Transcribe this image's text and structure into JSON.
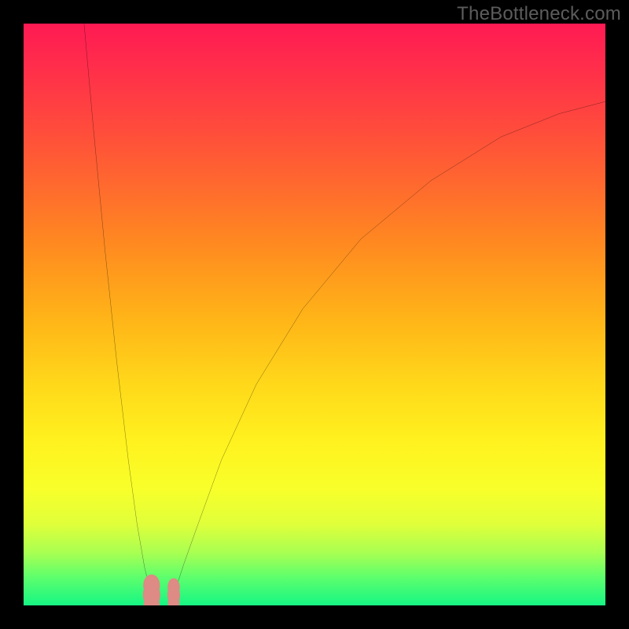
{
  "attribution": "TheBottleneck.com",
  "chart_data": {
    "type": "line",
    "title": "",
    "xlabel": "",
    "ylabel": "",
    "xlim": [
      0,
      100
    ],
    "ylim": [
      0,
      100
    ],
    "grid": false,
    "legend": false,
    "series": [
      {
        "name": "left-curve",
        "x": [
          10.4,
          12,
          14,
          16,
          18,
          19.5,
          20.8,
          21.8,
          22.4,
          22.8,
          23.0
        ],
        "y": [
          100,
          82,
          61,
          42,
          25,
          14,
          6.5,
          2.5,
          0.9,
          0.3,
          0.0
        ]
      },
      {
        "name": "right-curve",
        "x": [
          25.0,
          25.4,
          26.2,
          27.5,
          30,
          34,
          40,
          48,
          58,
          70,
          82,
          92,
          100
        ],
        "y": [
          0.0,
          0.8,
          3.0,
          7.0,
          14.0,
          25.0,
          38.0,
          51.0,
          63.0,
          73.0,
          80.5,
          84.5,
          86.6
        ]
      }
    ],
    "markers": [
      {
        "name": "cluster-left",
        "shape": "blob",
        "x": 22.0,
        "y": 1.8,
        "w": 3.0,
        "h": 5.5
      },
      {
        "name": "cluster-right",
        "shape": "blob",
        "x": 25.8,
        "y": 1.8,
        "w": 2.2,
        "h": 4.5
      }
    ],
    "colors": {
      "curve_stroke": "#000000",
      "marker_fill": "#dd8b84",
      "gradient_top": "#ff1a53",
      "gradient_mid": "#ffd81a",
      "gradient_bottom": "#16f684",
      "frame": "#000000",
      "attribution_text": "#5c5c5c"
    }
  }
}
